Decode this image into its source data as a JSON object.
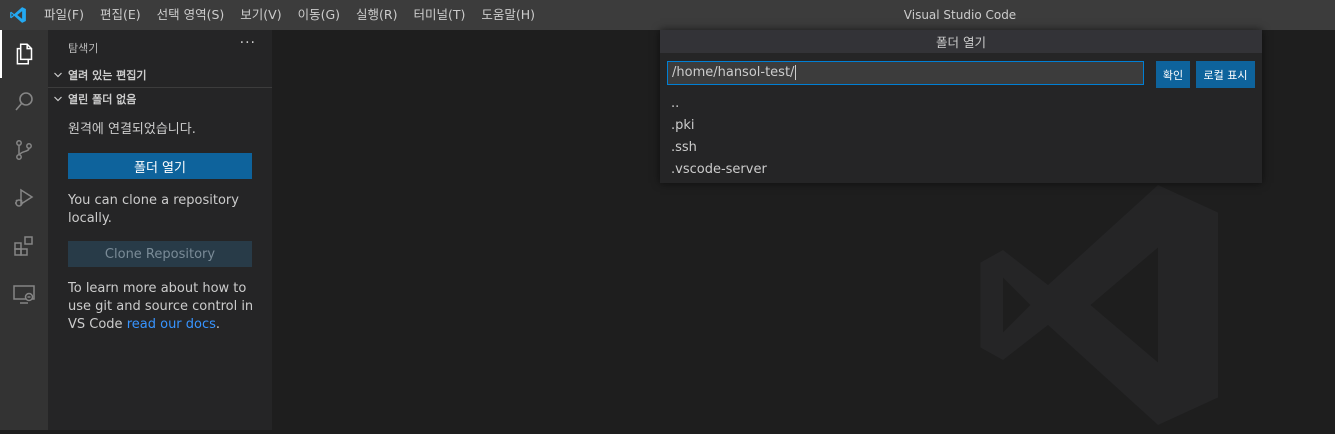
{
  "window": {
    "title": "Visual Studio Code"
  },
  "menu": [
    "파일(F)",
    "편집(E)",
    "선택 영역(S)",
    "보기(V)",
    "이동(G)",
    "실행(R)",
    "터미널(T)",
    "도움말(H)"
  ],
  "activity_bar": {
    "icons": [
      "explorer-icon",
      "search-icon",
      "source-control-icon",
      "run-debug-icon",
      "extensions-icon",
      "remote-explorer-icon"
    ],
    "active": "explorer-icon"
  },
  "sidebar": {
    "header": "탐색기",
    "more": "···",
    "sections": [
      "열려 있는 편집기",
      "열린 폴더 없음"
    ],
    "remote_msg": "원격에 연결되었습니다.",
    "open_folder_button": "폴더 열기",
    "clone_msg": "You can clone a repository locally.",
    "clone_button": "Clone Repository",
    "learn_msg_prefix": "To learn more about how to use git and source control in VS Code ",
    "learn_link": "read our docs",
    "learn_msg_suffix": "."
  },
  "quick_pick": {
    "title": "폴더 열기",
    "input_value": "/home/hansol-test/",
    "ok_button": "확인",
    "show_local_button": "로컬 표시",
    "items": [
      "..",
      ".pki",
      ".ssh",
      ".vscode-server"
    ]
  },
  "colors": {
    "titlebar": "#3c3c3c",
    "activitybar": "#333333",
    "sidebar": "#252526",
    "editor": "#1e1e1e",
    "button": "#0e639c",
    "focus_border": "#007fd4",
    "link": "#3794ff"
  }
}
